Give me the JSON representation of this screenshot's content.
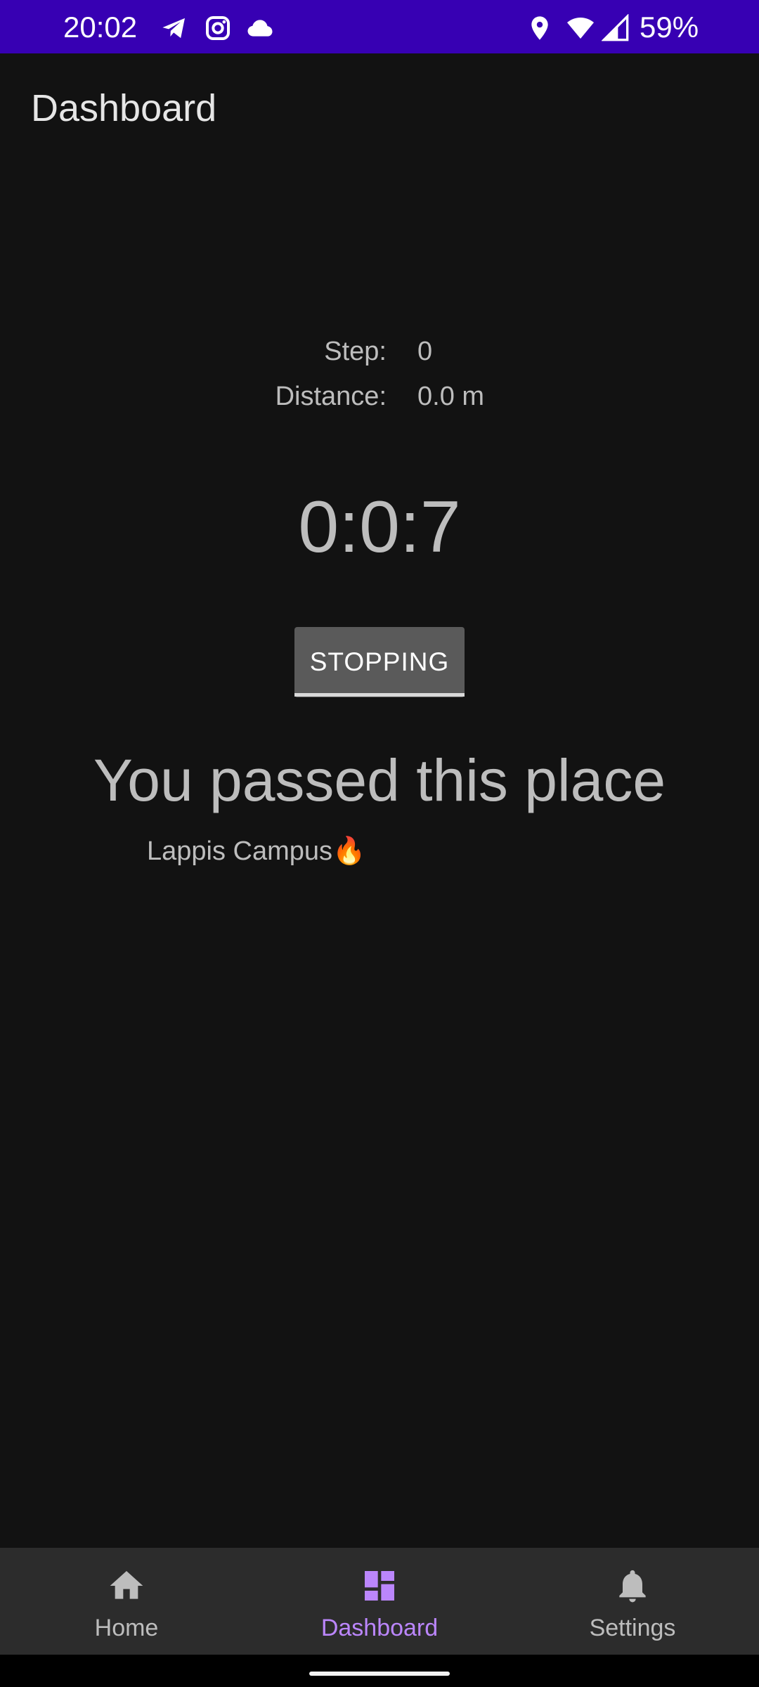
{
  "status_bar": {
    "time": "20:02",
    "battery": "59%",
    "left_icons": [
      "telegram-icon",
      "instagram-icon",
      "cloud-icon"
    ],
    "right_icons": [
      "location-icon",
      "wifi-icon",
      "cell-signal-icon"
    ],
    "background_color": "#3700b3"
  },
  "app_bar": {
    "title": "Dashboard"
  },
  "stats": {
    "step_label": "Step:",
    "step_value": "0",
    "distance_label": "Distance:",
    "distance_value": "0.0 m"
  },
  "timer": {
    "value": "0:0:7"
  },
  "action_button": {
    "label": "STOPPING"
  },
  "passed": {
    "heading": "You passed this place",
    "place_name": "Lappis Campus🔥"
  },
  "bottom_nav": {
    "accent_color": "#bb86fc",
    "items": [
      {
        "label": "Home",
        "icon": "home-icon",
        "selected": false
      },
      {
        "label": "Dashboard",
        "icon": "dashboard-icon",
        "selected": true
      },
      {
        "label": "Settings",
        "icon": "bell-icon",
        "selected": false
      }
    ]
  }
}
